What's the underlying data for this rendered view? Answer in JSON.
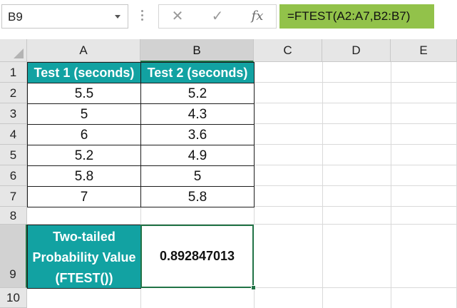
{
  "formula_bar": {
    "name_box": "B9",
    "cancel_icon": "✕",
    "enter_icon": "✓",
    "fx_label": "fx",
    "formula": "=FTEST(A2:A7,B2:B7)"
  },
  "columns": [
    "A",
    "B",
    "C",
    "D",
    "E"
  ],
  "rows": [
    "1",
    "2",
    "3",
    "4",
    "5",
    "6",
    "7",
    "8",
    "9",
    "10"
  ],
  "table": {
    "headers": [
      "Test 1 (seconds)",
      "Test 2 (seconds)"
    ],
    "rows": [
      [
        "5.5",
        "5.2"
      ],
      [
        "5",
        "4.3"
      ],
      [
        "6",
        "3.6"
      ],
      [
        "5.2",
        "4.9"
      ],
      [
        "5.8",
        "5"
      ],
      [
        "7",
        "5.8"
      ]
    ]
  },
  "result": {
    "label": "Two-tailed Probability Value (FTEST())",
    "value": "0.892847013"
  },
  "colors": {
    "header_fill": "#12a2a2",
    "formula_highlight": "#92c24a",
    "selection": "#217346"
  }
}
